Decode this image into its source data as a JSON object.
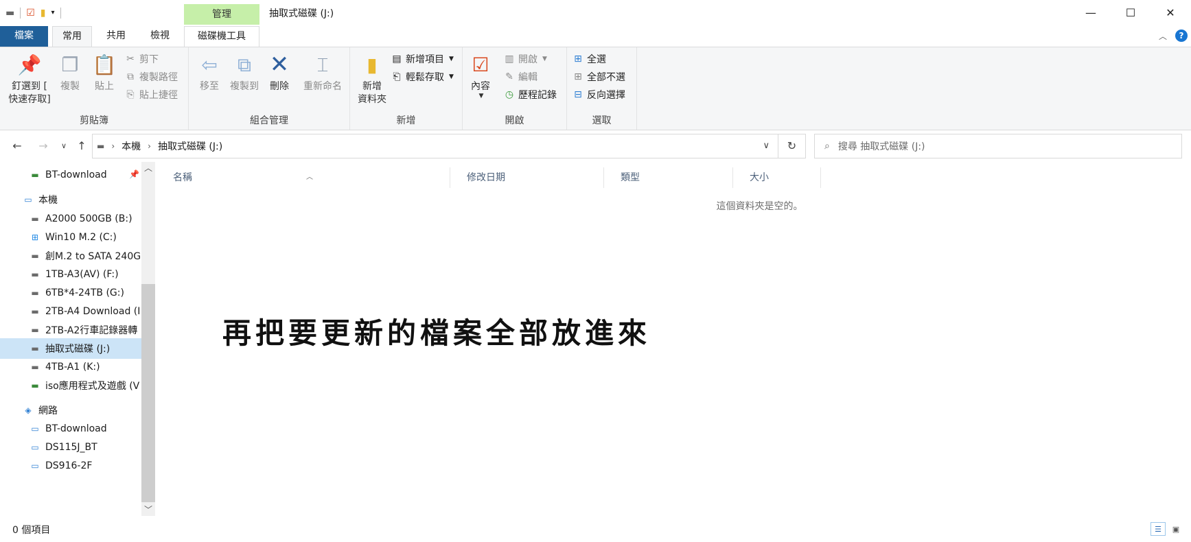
{
  "window": {
    "title": "抽取式磁碟 (J:)",
    "context_tab": "管理",
    "minimize_icon": "—",
    "maximize_icon": "☐",
    "close_icon": "✕"
  },
  "tabs": {
    "file": "檔案",
    "home": "常用",
    "share": "共用",
    "view": "檢視",
    "drive_tools": "磁碟機工具",
    "help": "?"
  },
  "ribbon": {
    "clipboard": {
      "label": "剪貼簿",
      "pin_line1": "釘選到 [",
      "pin_line2": "快速存取]",
      "copy": "複製",
      "paste": "貼上",
      "cut": "剪下",
      "copy_path": "複製路徑",
      "paste_shortcut": "貼上捷徑"
    },
    "organize": {
      "label": "組合管理",
      "move_to": "移至",
      "copy_to": "複製到",
      "delete": "刪除",
      "rename": "重新命名"
    },
    "new": {
      "label": "新增",
      "new_folder_line1": "新增",
      "new_folder_line2": "資料夾",
      "new_item": "新增項目",
      "easy_access": "輕鬆存取"
    },
    "open": {
      "label": "開啟",
      "properties": "內容",
      "open": "開啟",
      "edit": "編輯",
      "history": "歷程記錄"
    },
    "select": {
      "label": "選取",
      "select_all": "全選",
      "select_none": "全部不選",
      "invert": "反向選擇"
    }
  },
  "address": {
    "breadcrumb": [
      "本機",
      "抽取式磁碟 (J:)"
    ],
    "search_placeholder": "搜尋 抽取式磁碟 (J:)"
  },
  "nav": {
    "items": [
      {
        "label": "BT-download",
        "icon": "network-drive-icon",
        "indent": 2,
        "pinned": true
      },
      {
        "label": "本機",
        "icon": "computer-icon",
        "indent": 1
      },
      {
        "label": "A2000 500GB (B:)",
        "icon": "drive-icon",
        "indent": 2
      },
      {
        "label": "Win10 M.2 (C:)",
        "icon": "windows-drive-icon",
        "indent": 2
      },
      {
        "label": "創M.2 to SATA 240G",
        "icon": "drive-icon",
        "indent": 2
      },
      {
        "label": "1TB-A3(AV) (F:)",
        "icon": "drive-icon",
        "indent": 2
      },
      {
        "label": "6TB*4-24TB (G:)",
        "icon": "drive-icon",
        "indent": 2
      },
      {
        "label": "2TB-A4 Download (I",
        "icon": "drive-icon",
        "indent": 2
      },
      {
        "label": "2TB-A2行車記錄器轉",
        "icon": "drive-icon",
        "indent": 2
      },
      {
        "label": "抽取式磁碟 (J:)",
        "icon": "removable-drive-icon",
        "indent": 2,
        "selected": true
      },
      {
        "label": "4TB-A1 (K:)",
        "icon": "drive-icon",
        "indent": 2
      },
      {
        "label": "iso應用程式及遊戲 (V",
        "icon": "network-drive-icon",
        "indent": 2
      },
      {
        "label": "網路",
        "icon": "network-icon",
        "indent": 1
      },
      {
        "label": "BT-download",
        "icon": "network-computer-icon",
        "indent": 2
      },
      {
        "label": "DS115J_BT",
        "icon": "network-computer-icon",
        "indent": 2
      },
      {
        "label": "DS916-2F",
        "icon": "network-computer-icon",
        "indent": 2
      }
    ]
  },
  "filelist": {
    "columns": [
      "名稱",
      "修改日期",
      "類型",
      "大小"
    ],
    "empty_message": "這個資料夾是空的。",
    "overlay_text": "再把要更新的檔案全部放進來"
  },
  "status": {
    "item_count": "0 個項目"
  },
  "colors": {
    "file_tab": "#1f5f99",
    "manage_tab": "#c6efa9",
    "selection": "#cce4f7",
    "help": "#1976d2"
  }
}
